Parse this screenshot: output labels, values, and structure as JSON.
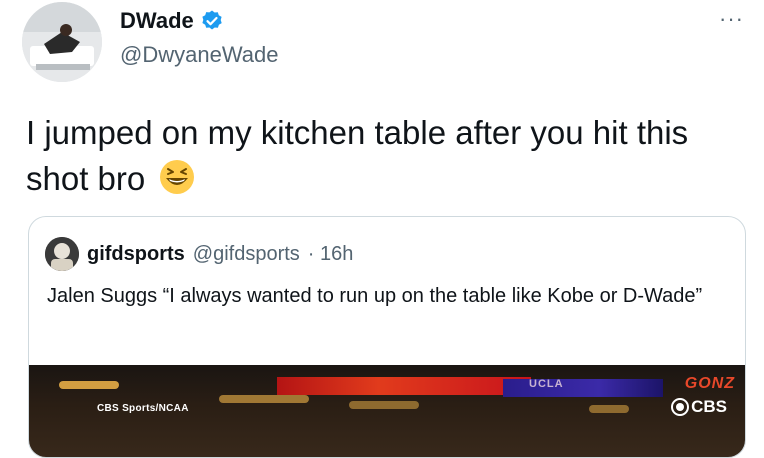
{
  "tweet": {
    "author": {
      "name": "DWade",
      "handle": "@DwyaneWade",
      "verified": true,
      "avatar_icon": "profile-photo"
    },
    "more_menu_label": "···",
    "text": "I jumped on my kitchen table after you hit this shot bro",
    "emoji_icon": "grinning-squinting-face-emoji"
  },
  "quoted_tweet": {
    "author_name": "gifdsports",
    "handle": "@gifdsports",
    "time": "· 16h",
    "text": "Jalen Suggs “I always wanted to run up on the table like Kobe or D-Wade”",
    "media": {
      "network_label": "CBS Sports/NCAA",
      "score_label": "GONZ",
      "broadcaster_label": "CBS",
      "sign_text": "UCLA"
    }
  },
  "colors": {
    "text_primary": "#0f1419",
    "text_secondary": "#536471",
    "verified_blue": "#1d9bf0",
    "border": "#cfd9de"
  }
}
